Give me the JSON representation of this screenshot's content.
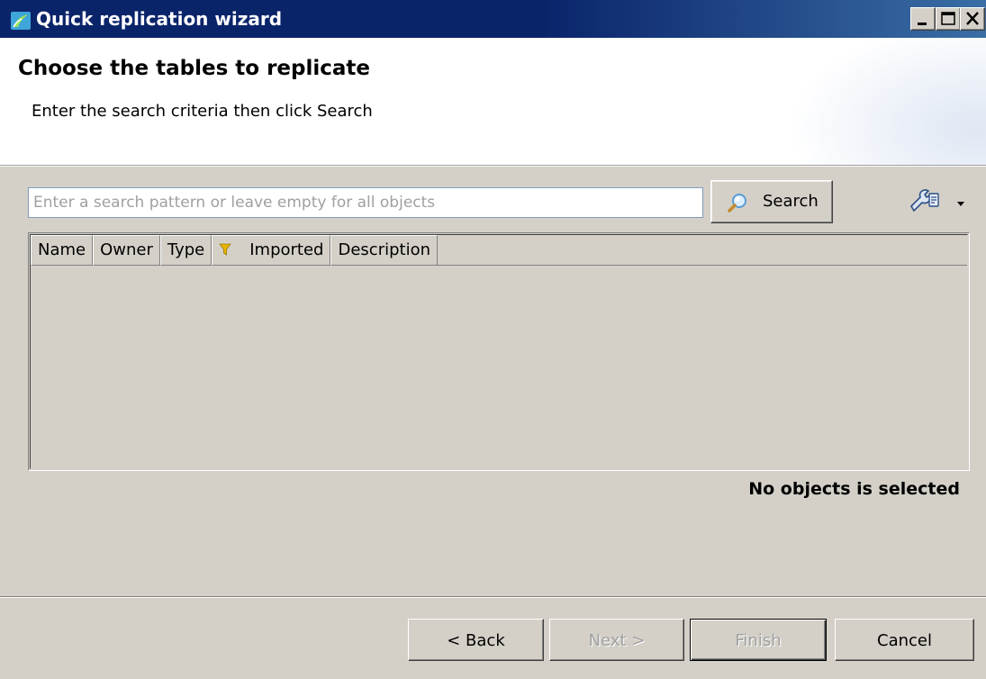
{
  "window": {
    "title": "Quick replication wizard",
    "controls": [
      "minimize",
      "maximize",
      "close"
    ]
  },
  "header": {
    "title": "Choose the tables to replicate",
    "subtitle": "Enter the search criteria then click Search"
  },
  "search": {
    "placeholder": "Enter a search pattern or leave empty for all objects",
    "value": "",
    "button_label": "Search",
    "button_icon": "magnifier-icon",
    "tools_icon": "tools-dropdown-icon"
  },
  "table": {
    "columns": [
      "Name",
      "Owner",
      "Type",
      "Imported",
      "Description"
    ],
    "rows": []
  },
  "status": {
    "text": "No objects is selected"
  },
  "footer": {
    "back_label": "< Back",
    "next_label": "Next >",
    "finish_label": "Finish",
    "cancel_label": "Cancel"
  },
  "colors": {
    "titlebar": "#0a246a",
    "face": "#d4d0c8",
    "filter_icon": "#e8b400"
  }
}
